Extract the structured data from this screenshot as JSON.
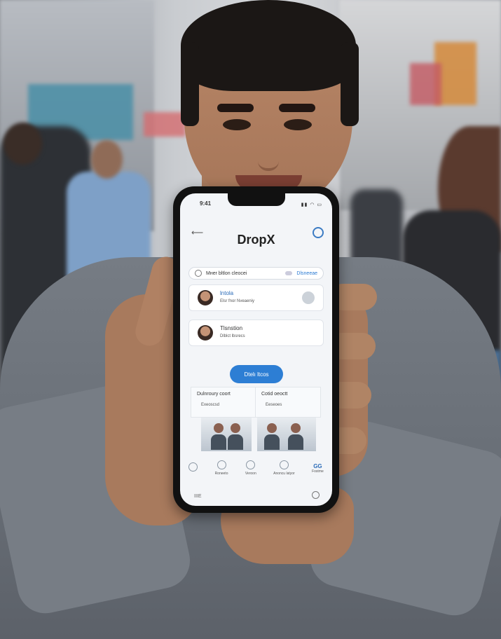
{
  "app": {
    "title": "DropX",
    "status_left": "9:41",
    "status_right": "▮▮ ◠ ▭"
  },
  "search": {
    "text": "Mнеr bltlon cleocei",
    "link": "Dlsneeae"
  },
  "cards": [
    {
      "title": "lntola",
      "subtitle": "Elsr fnor Nveaeniy"
    },
    {
      "title": "Tlsnstion",
      "subtitle": "Dlblct lbsrecs"
    }
  ],
  "cta": {
    "label": "Dtelı ltcos"
  },
  "panels": [
    {
      "title": "Dulnroury coort",
      "subtitle": "Exeoscsd"
    },
    {
      "title": "Cotid oeoctt",
      "subtitle": "Eeseoes"
    }
  ],
  "tabs": [
    {
      "label": "",
      "text": ""
    },
    {
      "label": "Roneeto",
      "text": ""
    },
    {
      "label": "Veroon",
      "text": ""
    },
    {
      "label": "Anoncu latyor",
      "text": ""
    },
    {
      "label": "Fostme",
      "text": "GG"
    }
  ],
  "footer": {
    "left": "IIIE"
  }
}
